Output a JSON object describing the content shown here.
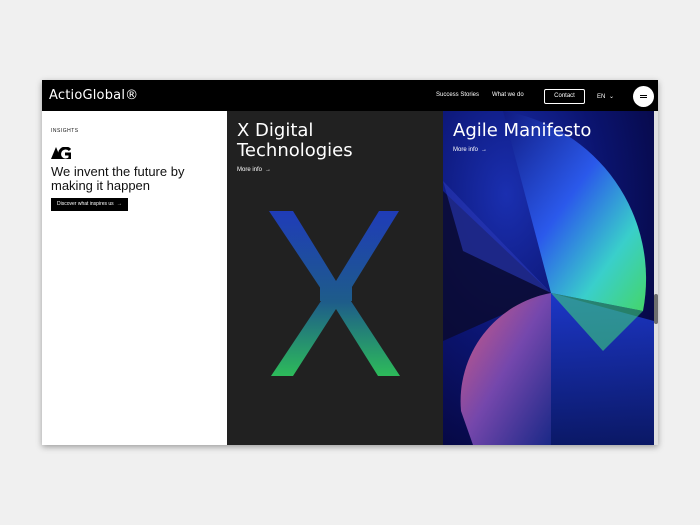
{
  "header": {
    "logo": "ActioGlobal®",
    "nav": [
      {
        "label": "Success Stories"
      },
      {
        "label": "What we do"
      }
    ],
    "contact_label": "Contact",
    "language": "EN",
    "language_chevron": "chevron-down-icon",
    "menu_icon": "hamburger-icon"
  },
  "insights": {
    "eyebrow": "INSIGHTS",
    "headline": "We invent the future by making it happen",
    "cta_label": "Discover what inspires us",
    "cta_arrow": "→"
  },
  "cards": [
    {
      "title": "X Digital Technologies",
      "more_label": "More info",
      "arrow": "→"
    },
    {
      "title": "Agile Manifesto",
      "more_label": "More info",
      "arrow": "→"
    }
  ],
  "colors": {
    "topbar": "#000000",
    "card_dark": "#212121",
    "agile_bg": "#07073a",
    "x_gradient_top": "#1f3cb8",
    "x_gradient_bottom": "#2dbb5a",
    "agile_accent_pink": "#e05a7a",
    "agile_accent_green": "#3fe07a",
    "agile_accent_blue": "#2a6bff"
  }
}
